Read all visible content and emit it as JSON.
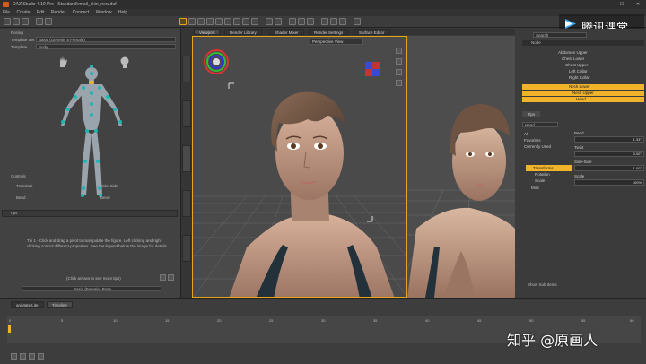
{
  "window": {
    "title": "DAZ Studio 4.10 Pro - Standard/email_skin_new.duf",
    "minimize": "—",
    "maximize": "☐",
    "close": "✕"
  },
  "menu": [
    "File",
    "Create",
    "Edit",
    "Render",
    "Connect",
    "Window",
    "Help"
  ],
  "logo": {
    "text": "腾讯课堂"
  },
  "left_panel": {
    "section": "Posing",
    "template_set_label": "Template Set",
    "template_set_value": "Basic (Genesis 8 Female)",
    "template_label": "Template",
    "template_value": "Body",
    "controls_title": "Controls",
    "controls": [
      "Translate",
      "Side-Side",
      "Bend",
      "Bend"
    ],
    "tips_tab": "Tips",
    "tip_text": "Tip 1 - Click and drag a pivot to manipulate the figure. Left clicking and right clicking control different properties. See the legend below the image for details.",
    "tip_nav": "(Click arrows to see more tips)",
    "bottom_field": "Basic (Female) Pose"
  },
  "viewport": {
    "tabs": [
      "Viewport",
      "Render Library",
      "Shader Mixer",
      "Render Settings",
      "Surface Editor"
    ],
    "camera": "Perspective View"
  },
  "scene_panel": {
    "search_placeholder": "Search",
    "header": "Node",
    "rows": [
      {
        "label": "Abdomen Upper",
        "selected": false
      },
      {
        "label": "Chest Lower",
        "selected": false
      },
      {
        "label": "Chest Upper",
        "selected": false
      },
      {
        "label": "Left Collar",
        "selected": false
      },
      {
        "label": "Right Collar",
        "selected": false
      },
      {
        "label": "Neck Lower",
        "selected": true
      },
      {
        "label": "Neck Upper",
        "selected": true
      },
      {
        "label": "Head",
        "selected": true
      }
    ]
  },
  "params_panel": {
    "tab": "Tips",
    "node": "Head",
    "categories": [
      {
        "label": "All",
        "selected": false
      },
      {
        "label": "Favorites",
        "selected": false
      },
      {
        "label": "Currently Used",
        "selected": false
      },
      {
        "label": "Transforms",
        "selected": true
      },
      {
        "label": "Rotation",
        "selected": false
      },
      {
        "label": "Scale",
        "selected": false
      },
      {
        "label": "Misc",
        "selected": false
      }
    ],
    "sliders": [
      {
        "label": "Bend",
        "value": "1.33°"
      },
      {
        "label": "Twist",
        "value": "0.00°"
      },
      {
        "label": "Side-Side",
        "value": "1.00°"
      },
      {
        "label": "Scale",
        "value": "100%"
      }
    ],
    "show_subitems": "Show Sub Items"
  },
  "timeline": {
    "tabs": [
      "aniMate Lite",
      "Timeline"
    ],
    "ticks": [
      "0",
      "5",
      "10",
      "15",
      "20",
      "25",
      "30",
      "35",
      "40",
      "45",
      "50",
      "55",
      "60"
    ]
  },
  "watermark": "知乎 @原画人"
}
